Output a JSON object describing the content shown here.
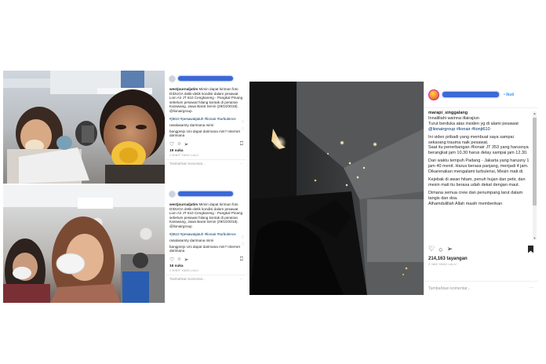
{
  "left_top_post": {
    "caption_user": "westjournaljatim",
    "caption_text": "Mimin dapat kiriman foto DIDUGA detik-detik kondisi dalam pesawat Lion Air JT 610 Cengkareng - Pangkal Pinang sebelum pesawat hilang kontak di perairan Karawang, Jawa Barat Senin (29/10/2018). @lionairgroup",
    "hashtags": "#jt610 #pesawatjatuh #lionair #turbulence",
    "comments": [
      {
        "text": "rasalasamty darimana mimi",
        "heart": "♡"
      },
      {
        "text": "bangprejo Uni dapat darimana min? Internet darimana",
        "heart": "♡"
      }
    ],
    "icons": {
      "like": "♡",
      "comment": "○",
      "share": "➢",
      "save": "⎕"
    },
    "likes": "19 suka",
    "time": "2 MINIT YANG LALU",
    "add_comment": "Tambahkan komentar...",
    "more": "···"
  },
  "left_bottom_post": {
    "caption_user": "westjournaljatim",
    "caption_text": "Mimin dapat kiriman foto DIDUGA detik-detik kondisi dalam pesawat Lion Air JT 610 Cengkareng - Pangkal Pinang sebelum pesawat hilang kontak di perairan Karawang, Jawa Barat Senin (29/10/2018). @lionairgroup",
    "hashtags": "#jt610 #pesawatjatuh #lionair #turbulence",
    "comments": [
      {
        "text": "rasalasamty darimana mimi",
        "heart": "♡"
      },
      {
        "text": "bangprejo Uni dapat darimana min? Internet darimana",
        "heart": "♡"
      }
    ],
    "icons": {
      "like": "♡",
      "comment": "○",
      "share": "➢",
      "save": "⎕"
    },
    "likes": "16 suka",
    "time": "2 MINIT YANG LALU",
    "add_comment": "Tambahkan komentar...",
    "more": "···"
  },
  "main_post": {
    "username": "marapi_singgalang",
    "follow": "• Ikuti",
    "caption_user": "marapi_singgalang",
    "paragraphs": [
      "Innalillahi wainna illairajiun",
      "Turut berduka atas insiden yg di alami pesawat",
      "Ini video pribadi yang membuat saya sampai sekarang trauma naik pesawat.",
      "Saat itu penerbangan #lionair JT 353 yang harusnya berangkat jam 10.30 harus delay sampai jam 12.30.",
      "Dan waktu tempuh Padang - Jakarta yang harusny 1 jam 40 menit. Harus berasa panjang, menjadi 4 jam.",
      "Dikarenakan mengalami turbulensi, Mesin mati di.",
      "Kejebak di awan hitam, penuh hujan dan petir, dan mesin mati itu berasa udah dekat dengan maut.",
      "Dimana semua crew dan penumpang larut dalam tangis dan doa.",
      "Alhamdulillah Allah masih memberikan"
    ],
    "mentions": "@lionairgroup #lionair #lionjt610",
    "icons": {
      "like": "♡",
      "comment": "○",
      "share": "➢"
    },
    "views": "214,163 tayangan",
    "time": "2 JAM YANG LALU",
    "add_comment": "Tambahkan komentar...",
    "more": "···",
    "scroll_up": "▲",
    "scroll_down": "▼"
  }
}
